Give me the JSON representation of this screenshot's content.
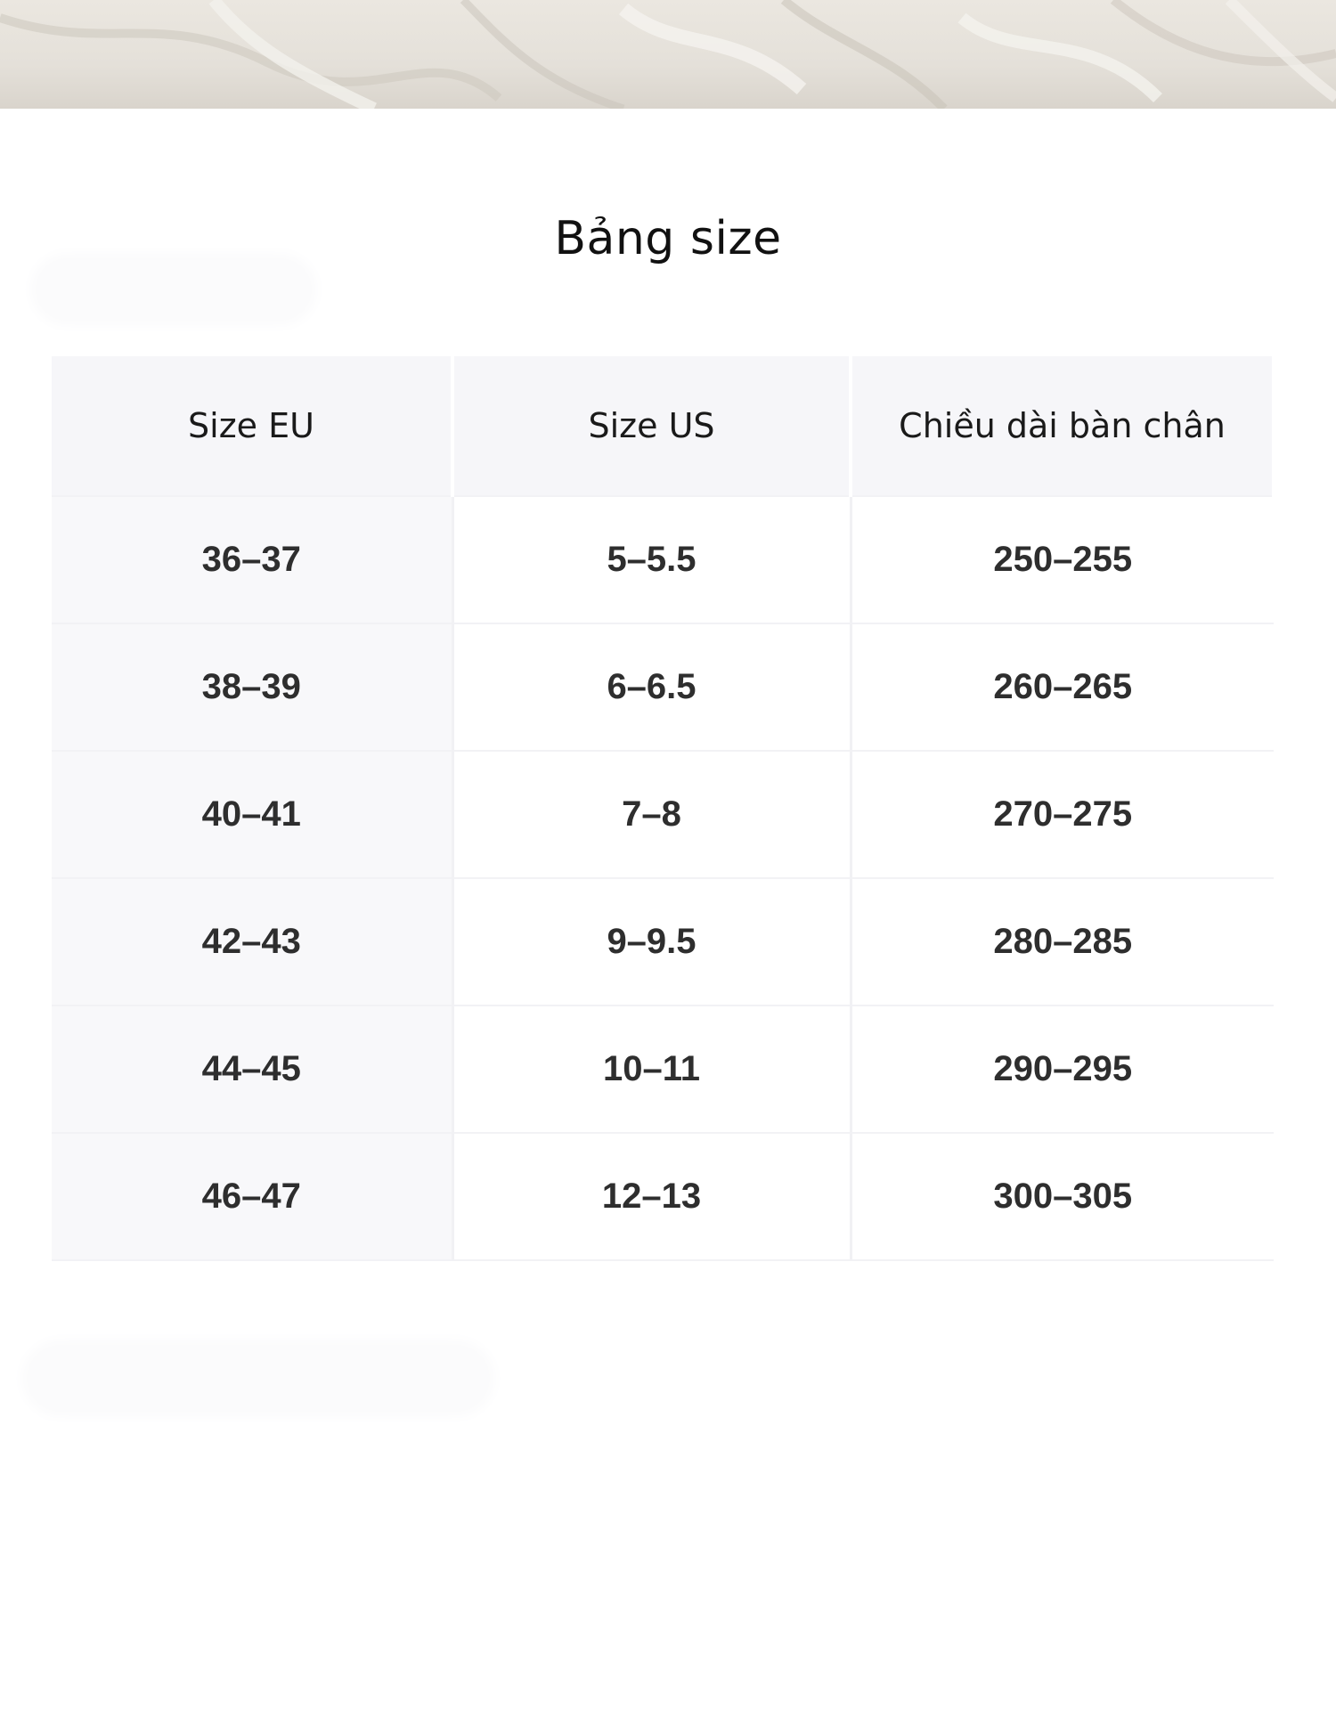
{
  "page": {
    "title": "Bảng size"
  },
  "size_table": {
    "headers": [
      "Size EU",
      "Size US",
      "Chiều dài bàn chân"
    ],
    "rows": [
      [
        "36–37",
        "5–5.5",
        "250–255"
      ],
      [
        "38–39",
        "6–6.5",
        "260–265"
      ],
      [
        "40–41",
        "7–8",
        "270–275"
      ],
      [
        "42–43",
        "9–9.5",
        "280–285"
      ],
      [
        "44–45",
        "10–11",
        "290–295"
      ],
      [
        "46–47",
        "12–13",
        "300–305"
      ]
    ]
  },
  "colors": {
    "header_bg": "#f6f6f9",
    "eu_column_bg": "#f8f8fa",
    "text": "#2e2e2e"
  }
}
